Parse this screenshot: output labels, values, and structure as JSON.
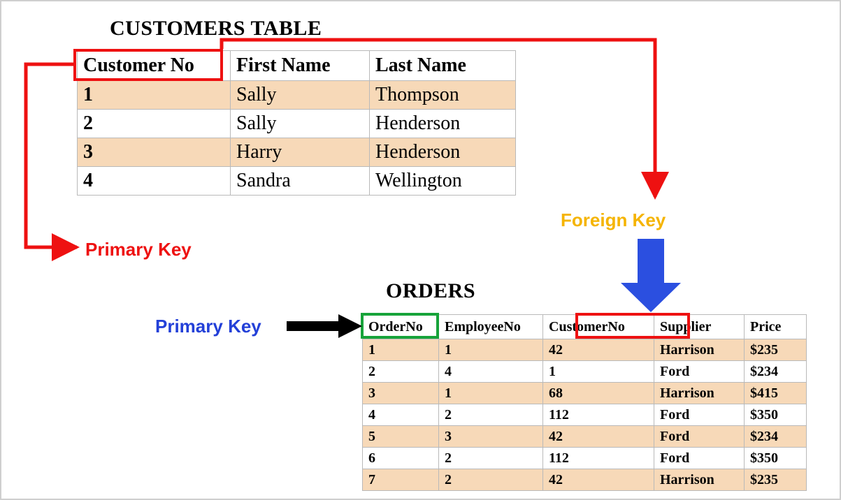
{
  "customers": {
    "title": "CUSTOMERS TABLE",
    "headers": {
      "c1": "Customer No",
      "c2": "First Name",
      "c3": "Last Name"
    },
    "rows": [
      {
        "no": "1",
        "first": "Sally",
        "last": "Thompson"
      },
      {
        "no": "2",
        "first": "Sally",
        "last": "Henderson"
      },
      {
        "no": "3",
        "first": "Harry",
        "last": "Henderson"
      },
      {
        "no": "4",
        "first": "Sandra",
        "last": "Wellington"
      }
    ]
  },
  "orders": {
    "title": "ORDERS",
    "headers": {
      "c1": "OrderNo",
      "c2": "EmployeeNo",
      "c3": "CustomerNo",
      "c4": "Supplier",
      "c5": "Price"
    },
    "rows": [
      {
        "no": "1",
        "emp": "1",
        "cust": "42",
        "sup": "Harrison",
        "price": "$235"
      },
      {
        "no": "2",
        "emp": "4",
        "cust": "1",
        "sup": "Ford",
        "price": "$234"
      },
      {
        "no": "3",
        "emp": "1",
        "cust": "68",
        "sup": "Harrison",
        "price": "$415"
      },
      {
        "no": "4",
        "emp": "2",
        "cust": "112",
        "sup": "Ford",
        "price": "$350"
      },
      {
        "no": "5",
        "emp": "3",
        "cust": "42",
        "sup": "Ford",
        "price": "$234"
      },
      {
        "no": "6",
        "emp": "2",
        "cust": "112",
        "sup": "Ford",
        "price": "$350"
      },
      {
        "no": "7",
        "emp": "2",
        "cust": "42",
        "sup": "Harrison",
        "price": "$235"
      }
    ]
  },
  "labels": {
    "primary_key_customers": "Primary Key",
    "primary_key_orders": "Primary Key",
    "foreign_key": "Foreign Key"
  },
  "colors": {
    "highlight_red": "#e11",
    "highlight_green": "#17a33a",
    "highlight_blue": "#2b4fe0",
    "highlight_yellow": "#f5b400",
    "row_alt": "#f7d9b8"
  }
}
